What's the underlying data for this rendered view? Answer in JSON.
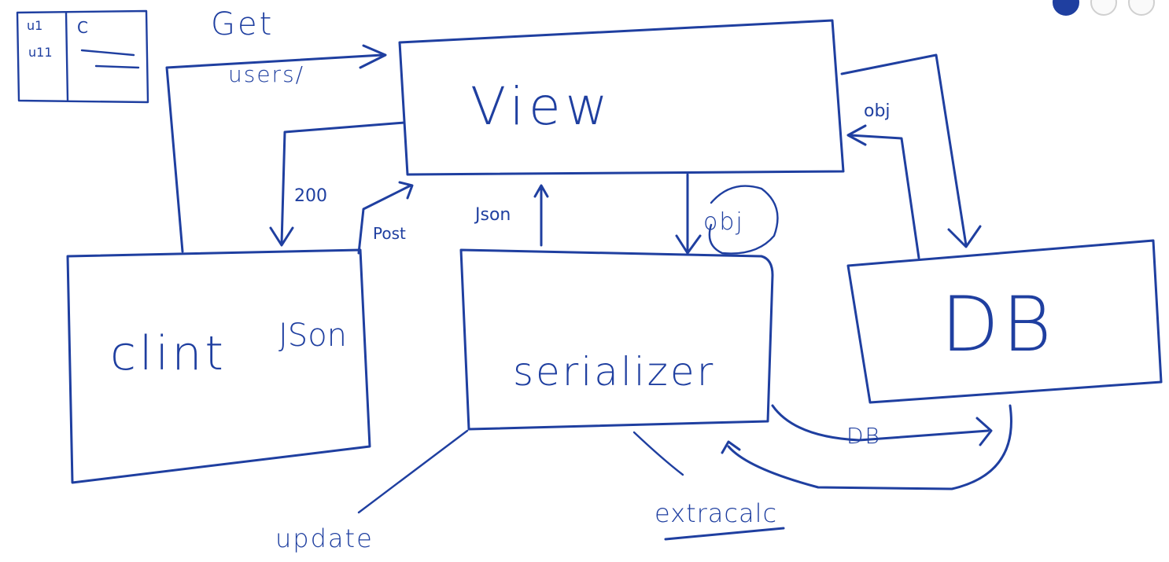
{
  "diagram": {
    "boxes": {
      "view": "View",
      "client": "clint",
      "client_sub": "JSon",
      "serializer": "serializer",
      "db": "DB"
    },
    "labels": {
      "get": "Get",
      "users_path": "users/",
      "status_200": "200",
      "post": "Post",
      "json_arrow": "Json",
      "obj_serializer": "obj",
      "obj_db": "obj",
      "db_link": "DB",
      "update": "update",
      "extra_calc": "extracalc"
    },
    "table_sketch": {
      "row_a": "u1",
      "row_b": "u11",
      "col_c": "C"
    }
  },
  "toolbar": {
    "tools": [
      "pen",
      "eraser",
      "more"
    ]
  },
  "colors": {
    "ink": "#1f3fa0",
    "background": "#ffffff"
  }
}
